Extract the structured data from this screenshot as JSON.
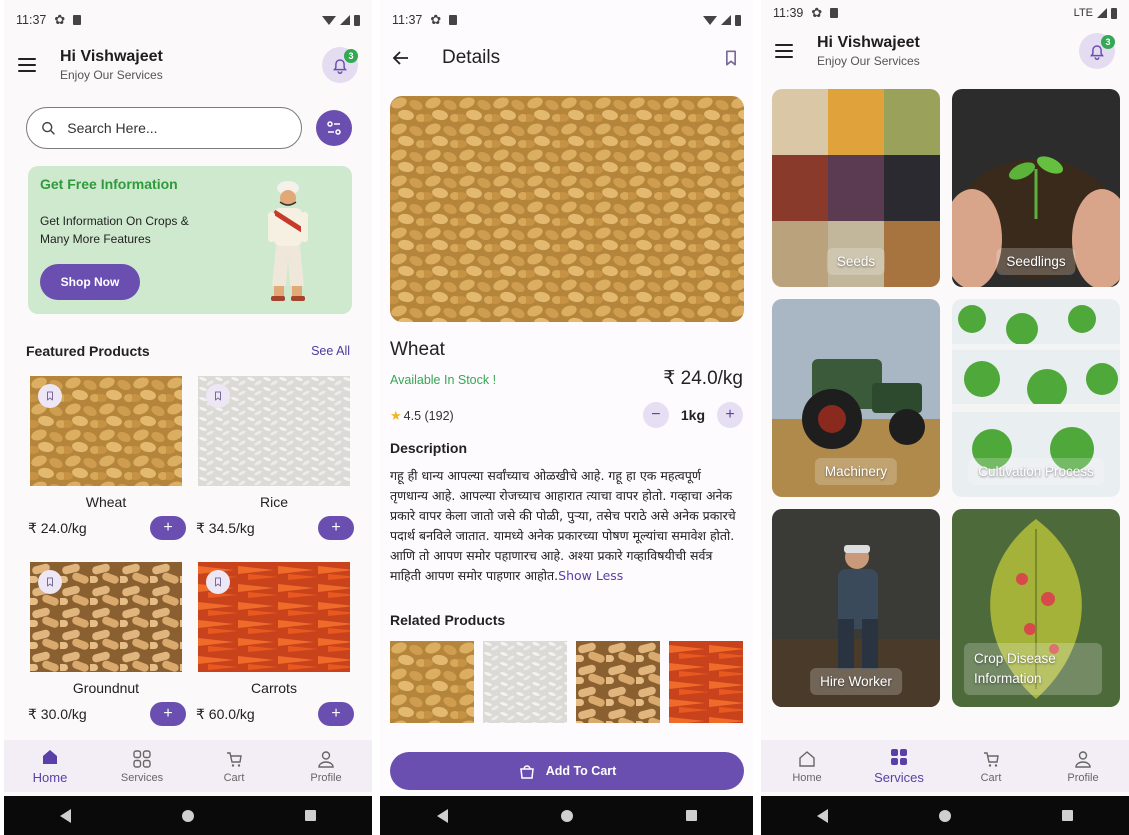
{
  "status": {
    "time1": "11:37",
    "time2": "11:37",
    "time3": "11:39",
    "network3": "LTE"
  },
  "home": {
    "greeting": "Hi Vishwajeet",
    "subtitle": "Enjoy Our Services",
    "notif_count": "3",
    "search_placeholder": "Search Here...",
    "banner": {
      "title": "Get Free Information",
      "text": "Get Information On Crops & Many More Features",
      "button": "Shop Now"
    },
    "featured_title": "Featured Products",
    "see_all": "See All",
    "products": [
      {
        "name": "Wheat",
        "price": "₹ 24.0/kg"
      },
      {
        "name": "Rice",
        "price": "₹ 34.5/kg"
      },
      {
        "name": "Groundnut",
        "price": "₹ 30.0/kg"
      },
      {
        "name": "Carrots",
        "price": "₹ 60.0/kg"
      }
    ],
    "add_symbol": "+"
  },
  "nav": {
    "home": "Home",
    "services": "Services",
    "cart": "Cart",
    "profile": "Profile"
  },
  "details": {
    "title": "Details",
    "name": "Wheat",
    "stock": "Available In Stock !",
    "price": "₹ 24.0/kg",
    "rating": "4.5 (192)",
    "qty": "1kg",
    "minus": "−",
    "plus": "+",
    "description_title": "Description",
    "description": "गहू ही धान्य आपल्या सर्वांच्याच ओळखीचे आहे. गहू हा एक महत्वपूर्ण तृणधान्य आहे. आपल्या रोजच्याच आहारात त्याचा वापर होतो. गव्हाचा अनेक प्रकारे वापर केला जातो जसे की पोळी, पुऱ्या, तसेच पराठे असे अनेक प्रकारचे पदार्थ बनविले जातात. यामध्ये अनेक प्रकारच्या पोषण मूल्यांचा समावेश होतो. आणि तो आपण समोर पहाणारच आहे. अश्या प्रकारे गव्हाविषयीची सर्वत्र माहिती आपण समोर पाहणार आहोत.",
    "show_less": "Show Less",
    "related_title": "Related Products",
    "add_to_cart": "Add To Cart"
  },
  "services": {
    "greeting": "Hi Vishwajeet",
    "subtitle": "Enjoy Our Services",
    "notif_count": "3",
    "tiles": [
      {
        "label": "Seeds"
      },
      {
        "label": "Seedlings"
      },
      {
        "label": "Machinery"
      },
      {
        "label": "Cultivation Process"
      },
      {
        "label": "Hire Worker"
      },
      {
        "label": "Crop Disease Information"
      }
    ]
  }
}
